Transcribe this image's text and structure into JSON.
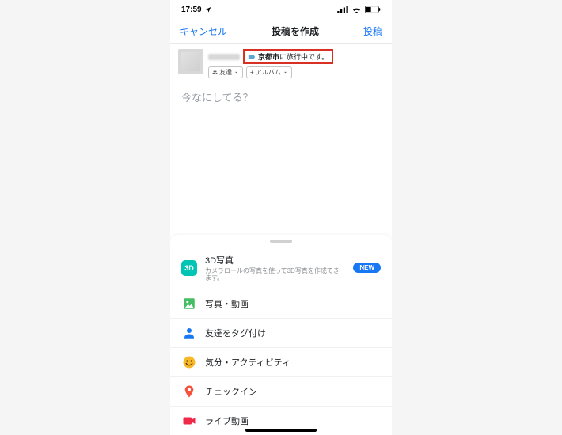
{
  "status": {
    "time": "17:59"
  },
  "nav": {
    "cancel": "キャンセル",
    "title": "投稿を作成",
    "post": "投稿"
  },
  "composer": {
    "location_prefix": "",
    "location_bold": "京都市",
    "location_suffix": "に旅行中です。",
    "chip_audience": "友達",
    "chip_album": "+ アルバム",
    "placeholder": "今なにしてる？"
  },
  "options": {
    "new_badge": "NEW",
    "opt0_title": "3D写真",
    "opt0_sub": "カメラロールの写真を使って3D写真を作成できます。",
    "opt0_icon_label": "3D",
    "opt1_title": "写真・動画",
    "opt2_title": "友達をタグ付け",
    "opt3_title": "気分・アクティビティ",
    "opt4_title": "チェックイン",
    "opt5_title": "ライブ動画"
  }
}
